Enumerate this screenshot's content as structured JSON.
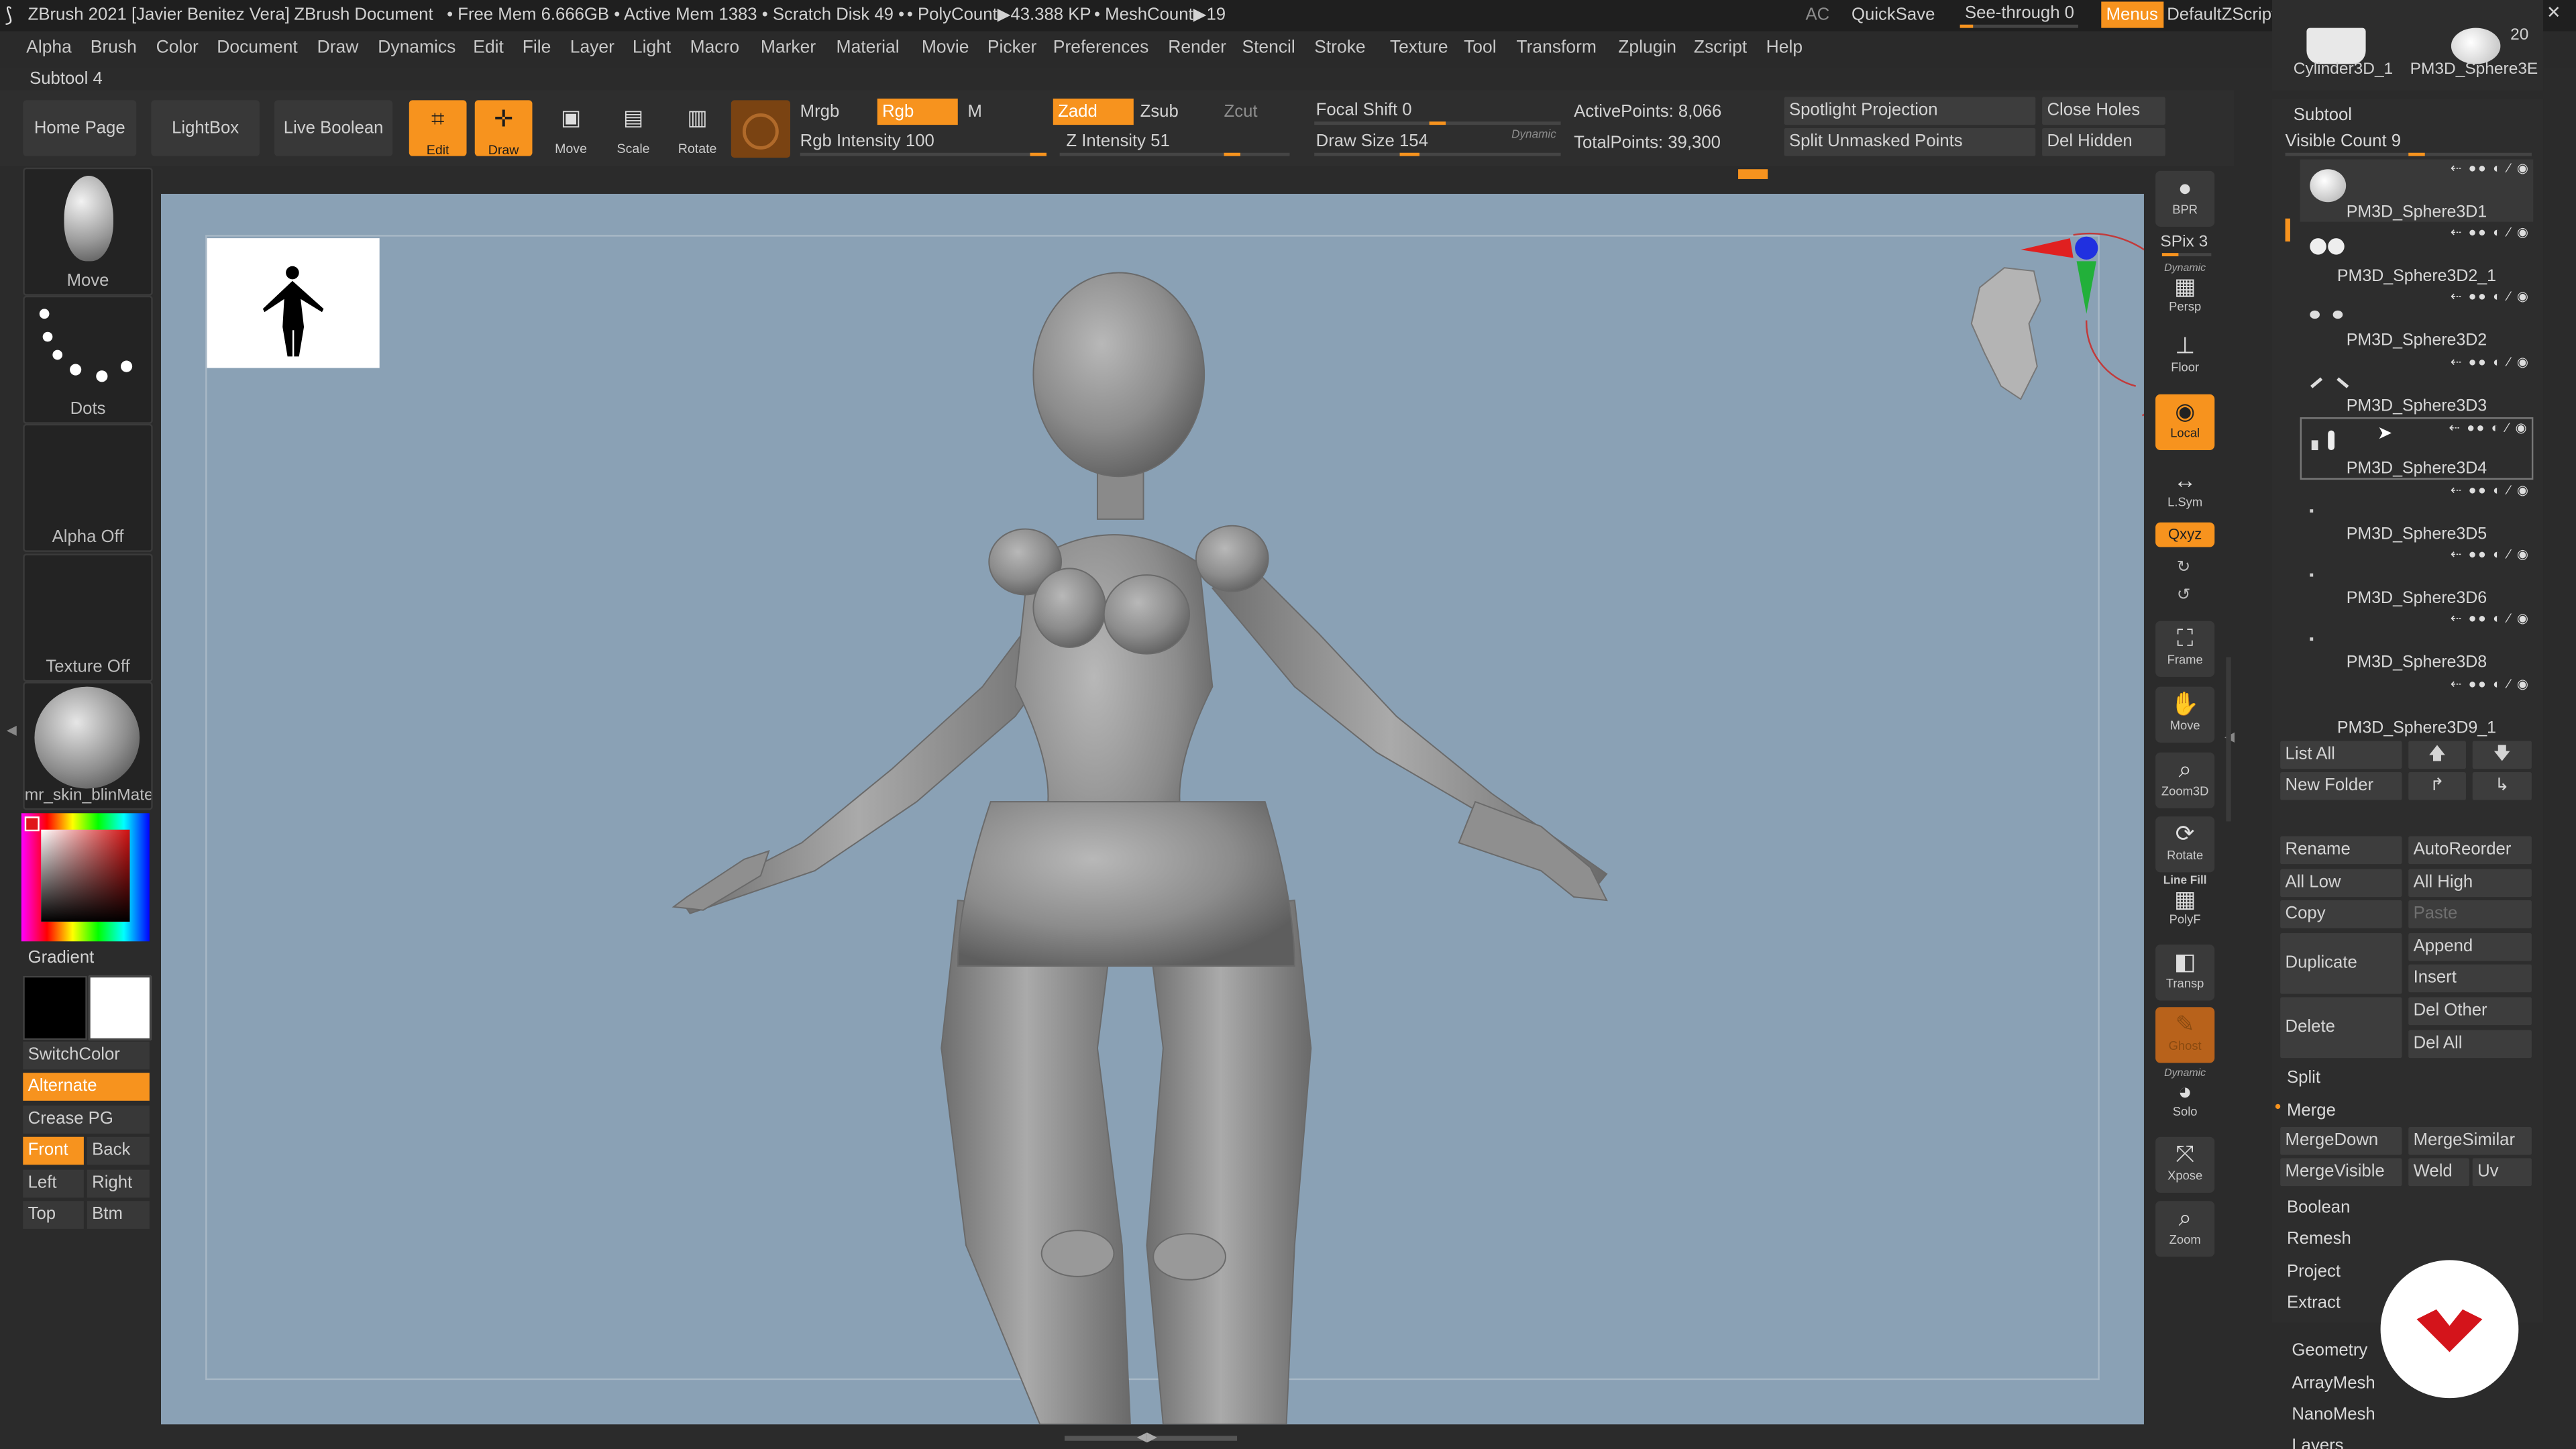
{
  "titlebar": {
    "app": "ZBrush 2021 [Javier Benitez Vera]",
    "doc": "ZBrush Document",
    "stats": "• Free Mem 6.666GB • Active Mem 1383 • Scratch Disk 49 •",
    "polycount": "• PolyCount▶43.388 KP",
    "meshcount": "• MeshCount▶19",
    "ac": "AC",
    "quicksave": "QuickSave",
    "seethrough": "See-through  0",
    "menus": "Menus",
    "zscript": "DefaultZScript"
  },
  "menus": [
    "Alpha",
    "Brush",
    "Color",
    "Document",
    "Draw",
    "Dynamics",
    "Edit",
    "File",
    "Layer",
    "Light",
    "Macro",
    "Marker",
    "Material",
    "Movie",
    "Picker",
    "Preferences",
    "Render",
    "Stencil",
    "Stroke",
    "Texture",
    "Tool",
    "Transform",
    "Zplugin",
    "Zscript",
    "Help"
  ],
  "subtool_label": "Subtool 4",
  "shelf": {
    "home": "Home Page",
    "lightbox": "LightBox",
    "liveboolean": "Live Boolean",
    "edit": "Edit",
    "draw": "Draw",
    "move": "Move",
    "scale": "Scale",
    "rotate": "Rotate",
    "mrgb": "Mrgb",
    "rgb": "Rgb",
    "m": "M",
    "rgb_intensity": "Rgb Intensity 100",
    "zadd": "Zadd",
    "zsub": "Zsub",
    "zcut": "Zcut",
    "z_intensity": "Z Intensity 51",
    "focal_shift": "Focal Shift 0",
    "draw_size": "Draw Size 154",
    "dynamic": "Dynamic",
    "active_points": "ActivePoints: 8,066",
    "total_points": "TotalPoints: 39,300",
    "spotlight": "Spotlight Projection",
    "split_unmasked": "Split Unmasked Points",
    "close_holes": "Close Holes",
    "del_hidden": "Del Hidden"
  },
  "left": {
    "move": "Move",
    "dots": "Dots",
    "alpha": "Alpha Off",
    "texture": "Texture Off",
    "material": "mr_skin_blinMate",
    "gradient": "Gradient",
    "switchcolor": "SwitchColor",
    "alternate": "Alternate",
    "crease": "Crease PG",
    "front": "Front",
    "back": "Back",
    "left": "Left",
    "right": "Right",
    "top": "Top",
    "btm": "Btm"
  },
  "vtool": {
    "bpr": "BPR",
    "spix": "SPix 3",
    "persp": "Persp",
    "dynamic": "Dynamic",
    "floor": "Floor",
    "local": "Local",
    "lsym": "L.Sym",
    "xyz": "Qxyz",
    "frame": "Frame",
    "move": "Move",
    "zoom3d": "Zoom3D",
    "rotate": "Rotate",
    "linefill": "Line Fill",
    "polyf": "PolyF",
    "transp": "Transp",
    "ghost": "Ghost",
    "solo_dyn": "Dynamic",
    "solo": "Solo",
    "xpose": "Xpose",
    "zoom": "Zoom"
  },
  "subtool": {
    "thumbs": [
      "Cylinder3D_1",
      "PM3D_Sphere3E"
    ],
    "count_top": "20",
    "title": "Subtool",
    "visible": "Visible Count 9",
    "items": [
      "PM3D_Sphere3D1",
      "PM3D_Sphere3D2_1",
      "PM3D_Sphere3D2",
      "PM3D_Sphere3D3",
      "PM3D_Sphere3D4",
      "PM3D_Sphere3D5",
      "PM3D_Sphere3D6",
      "PM3D_Sphere3D8",
      "PM3D_Sphere3D9_1"
    ],
    "list_all": "List All",
    "new_folder": "New Folder",
    "rename": "Rename",
    "autoreorder": "AutoReorder",
    "all_low": "All Low",
    "all_high": "All High",
    "copy": "Copy",
    "paste": "Paste",
    "duplicate": "Duplicate",
    "append": "Append",
    "insert": "Insert",
    "delete": "Delete",
    "del_other": "Del Other",
    "del_all": "Del All",
    "split": "Split",
    "merge": "Merge",
    "mergedown": "MergeDown",
    "mergesimilar": "MergeSimilar",
    "mergevisible": "MergeVisible",
    "weld": "Weld",
    "uv": "Uv",
    "boolean": "Boolean",
    "remesh": "Remesh",
    "project": "Project",
    "extract": "Extract",
    "geometry": "Geometry",
    "arraymesh": "ArrayMesh",
    "nanomesh": "NanoMesh",
    "layers": "Layers"
  },
  "colors": {
    "accent": "#f7931e",
    "canvas": "#8aa1b5",
    "panel": "#2b2b2b"
  }
}
